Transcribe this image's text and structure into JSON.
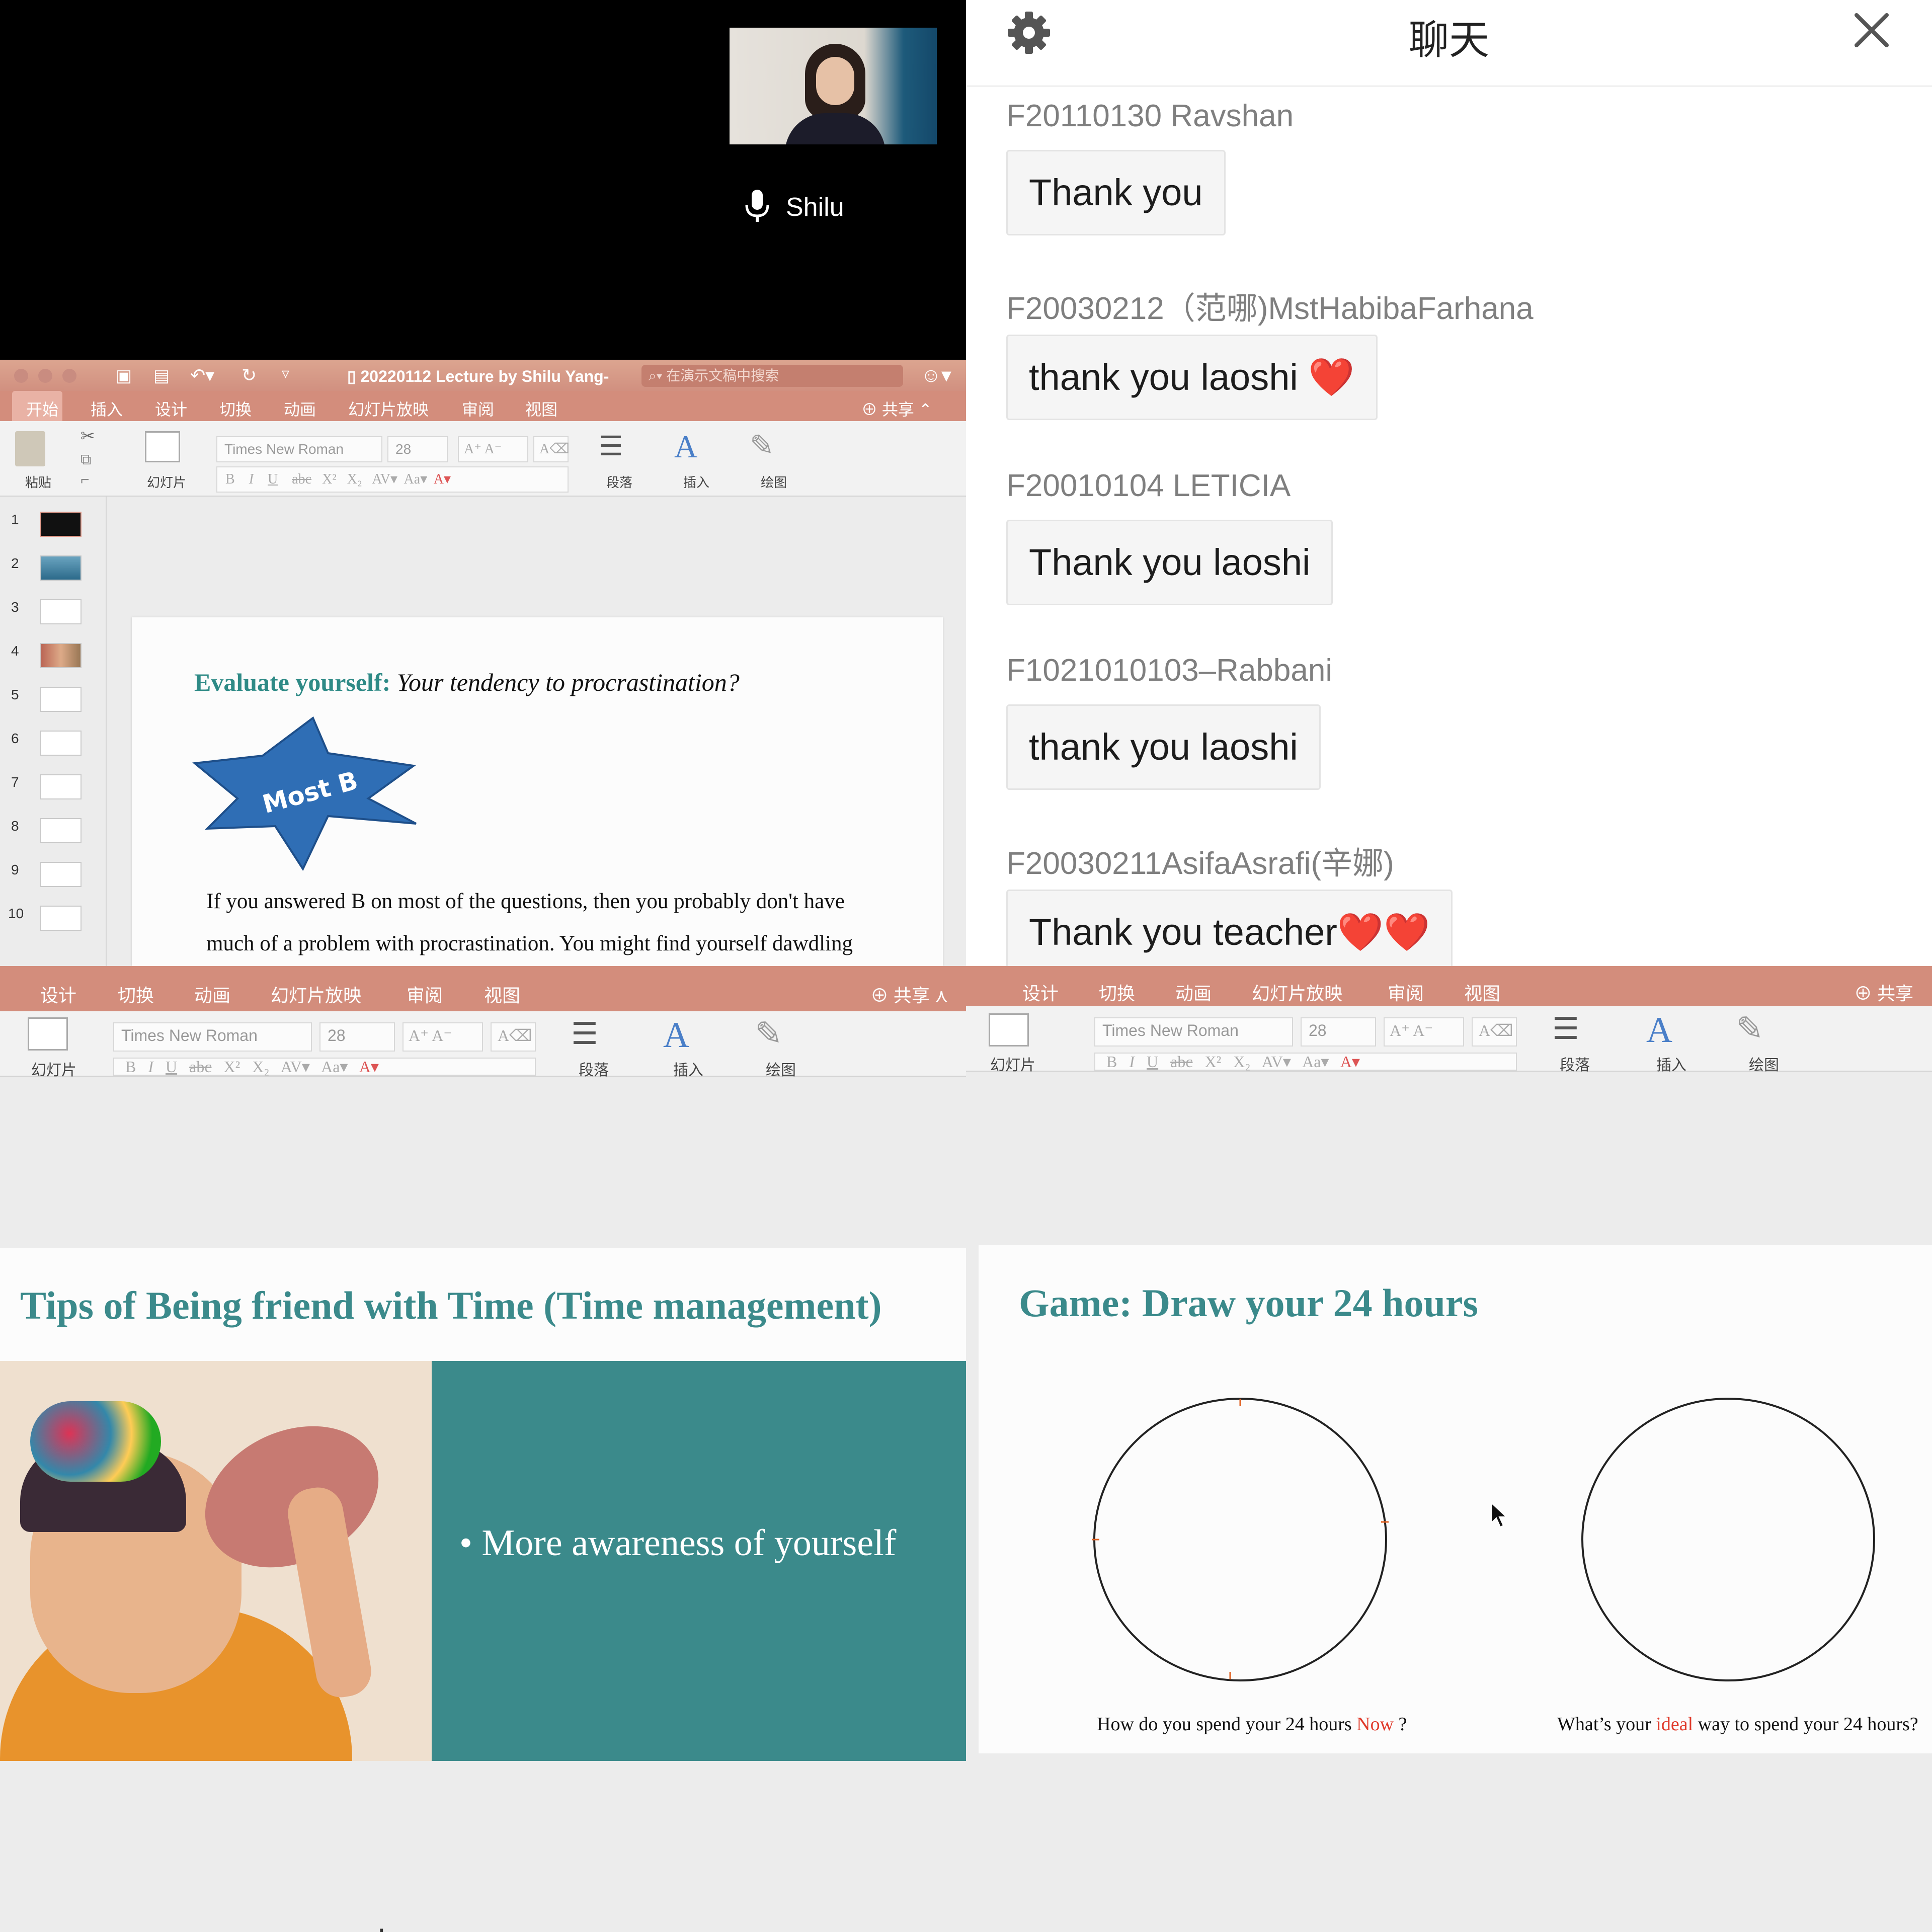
{
  "video": {
    "speaker_name": "Shilu",
    "mic_icon": "microphone-icon"
  },
  "chat": {
    "title": "聊天",
    "settings_icon": "gear-icon",
    "close_icon": "close-icon",
    "messages": [
      {
        "sender": "F20110130 Ravshan",
        "text": "Thank you"
      },
      {
        "sender": "F20030212（范哪)MstHabibaFarhana",
        "text": "thank you laoshi",
        "emoji": "❤️"
      },
      {
        "sender": "F20010104 LETICIA",
        "text": "Thank you laoshi"
      },
      {
        "sender": "F1021010103–Rabbani",
        "text": "thank you laoshi"
      },
      {
        "sender": "F20030211AsifaAsrafi(辛娜)",
        "text": "Thank you teacher",
        "emoji": "❤️❤️"
      }
    ]
  },
  "ppt_top": {
    "doc_title": "20220112 Lecture by Shilu Yang-",
    "search_placeholder": "在演示文稿中搜索",
    "tabs": [
      "开始",
      "插入",
      "设计",
      "切换",
      "动画",
      "幻灯片放映",
      "审阅",
      "视图"
    ],
    "share": "共享",
    "ribbon": {
      "paste": "粘贴",
      "slide": "幻灯片",
      "font": "Times New Roman",
      "size": "28",
      "paragraph": "段落",
      "insert": "插入",
      "draw": "绘图",
      "bold": "B",
      "italic": "I",
      "underline": "U",
      "strike": "abc",
      "superscript": "X²",
      "subscript": "X₂"
    },
    "thumb_numbers": [
      "1",
      "2",
      "3",
      "4",
      "5",
      "6",
      "7",
      "8",
      "9",
      "10"
    ],
    "slide": {
      "heading_label": "Evaluate yourself:",
      "heading_question": "Your tendency to procrastination?",
      "starburst": "Most B",
      "body_line1": "If you answered B on most of the questions, then you probably don't have",
      "body_line2": "much of a problem with procrastination. You might find yourself dawdling"
    }
  },
  "ppt_bottom_left": {
    "tabs": [
      "设计",
      "切换",
      "动画",
      "幻灯片放映",
      "审阅",
      "视图"
    ],
    "share": "共享",
    "ribbon": {
      "slide": "幻灯片",
      "font": "Times New Roman",
      "size": "28",
      "paragraph": "段落",
      "insert": "插入",
      "draw": "绘图"
    },
    "slide": {
      "title": "Tips of Being friend with Time (Time management)",
      "bullet": "More awareness of yourself"
    }
  },
  "ppt_bottom_right": {
    "tabs": [
      "设计",
      "切换",
      "动画",
      "幻灯片放映",
      "审阅",
      "视图"
    ],
    "share": "共享",
    "ribbon": {
      "slide": "幻灯片",
      "font": "Times New Roman",
      "size": "28",
      "paragraph": "段落",
      "insert": "插入",
      "draw": "绘图"
    },
    "slide": {
      "title": "Game: Draw your 24 hours",
      "caption_left_pre": "How do you spend your 24 hours ",
      "caption_left_em": "Now",
      "caption_left_post": " ?",
      "caption_right_pre": "What’s your ",
      "caption_right_em": "ideal",
      "caption_right_post": " way to spend your 24 hours?"
    }
  },
  "colors": {
    "ppt_accent": "#d38d7c",
    "teal": "#3b8a8b",
    "heart": "#e0202a",
    "emphasis_red": "#e03a2a"
  }
}
